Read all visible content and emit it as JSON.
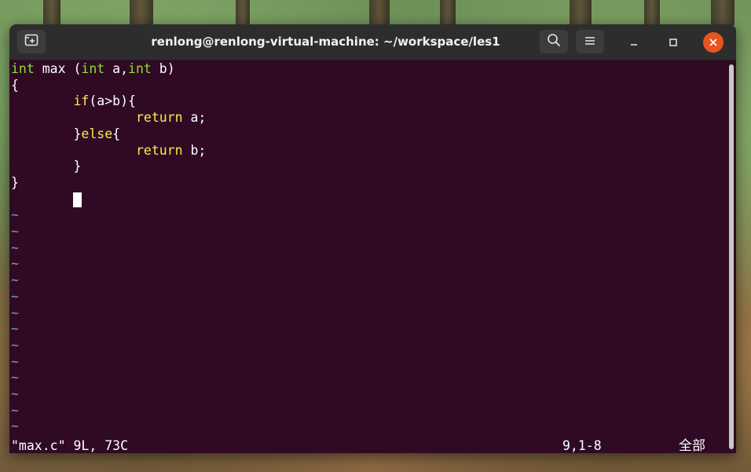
{
  "window": {
    "title": "renlong@renlong-virtual-machine: ~/workspace/les1",
    "new_tab_icon": "new-tab-icon",
    "search_icon": "search-icon",
    "menu_icon": "hamburger-menu-icon",
    "minimize_icon": "minimize-icon",
    "maximize_icon": "maximize-icon",
    "close_icon": "close-icon"
  },
  "editor": {
    "lines": [
      {
        "segments": [
          {
            "t": "int",
            "c": "type"
          },
          {
            "t": " max (",
            "c": "plain"
          },
          {
            "t": "int",
            "c": "type"
          },
          {
            "t": " a,",
            "c": "plain"
          },
          {
            "t": "int",
            "c": "type"
          },
          {
            "t": " b)",
            "c": "plain"
          }
        ]
      },
      {
        "segments": [
          {
            "t": "{",
            "c": "plain"
          }
        ]
      },
      {
        "segments": [
          {
            "t": "        ",
            "c": "plain"
          },
          {
            "t": "if",
            "c": "kw"
          },
          {
            "t": "(a>b){",
            "c": "plain"
          }
        ]
      },
      {
        "segments": [
          {
            "t": "                ",
            "c": "plain"
          },
          {
            "t": "return",
            "c": "kw"
          },
          {
            "t": " a;",
            "c": "plain"
          }
        ]
      },
      {
        "segments": [
          {
            "t": "        }",
            "c": "plain"
          },
          {
            "t": "else",
            "c": "kw"
          },
          {
            "t": "{",
            "c": "plain"
          }
        ]
      },
      {
        "segments": [
          {
            "t": "                ",
            "c": "plain"
          },
          {
            "t": "return",
            "c": "kw"
          },
          {
            "t": " b;",
            "c": "plain"
          }
        ]
      },
      {
        "segments": [
          {
            "t": "        }",
            "c": "plain"
          }
        ]
      },
      {
        "segments": [
          {
            "t": "}",
            "c": "plain"
          }
        ]
      },
      {
        "segments": [
          {
            "t": "",
            "c": "plain"
          }
        ]
      }
    ],
    "tilde": "~",
    "tilde_count": 14,
    "status": {
      "file_info": "\"max.c\" 9L, 73C",
      "position": "9,1-8",
      "scroll": "全部"
    }
  },
  "colors": {
    "terminal_bg": "#300a24",
    "titlebar_bg": "#2d2d2d",
    "type_green": "#8ae234",
    "keyword_yellow": "#fce94f",
    "tilde_blue": "#729fcf",
    "close_orange": "#e95420"
  }
}
